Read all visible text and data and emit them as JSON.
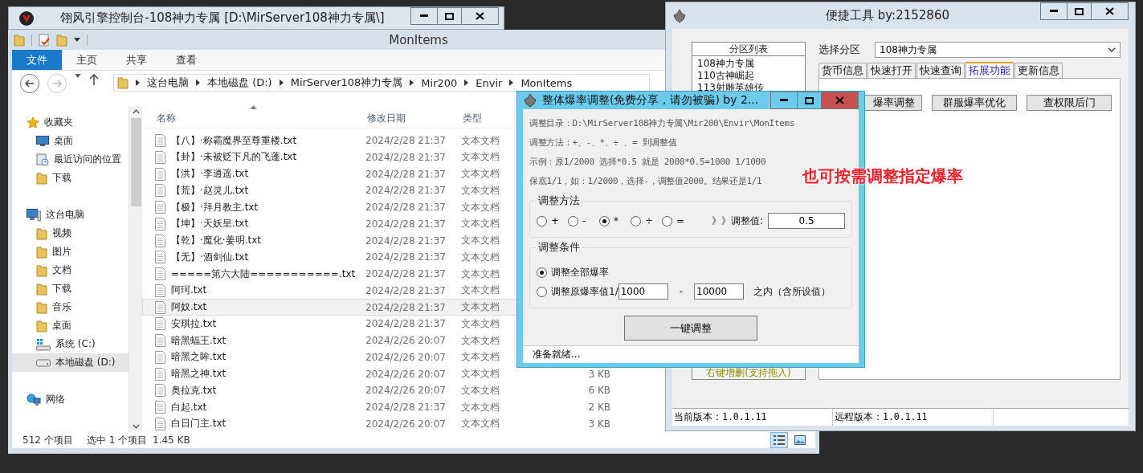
{
  "console_window": {
    "title": "翎风引擎控制台-108神力专属 [D:\\MirServer108神力专属\\]"
  },
  "explorer": {
    "title": "MonItems",
    "ribbon_tabs": [
      {
        "label": "文件",
        "selected": true
      },
      {
        "label": "主页",
        "selected": false
      },
      {
        "label": "共享",
        "selected": false
      },
      {
        "label": "查看",
        "selected": false
      }
    ],
    "breadcrumb": [
      "这台电脑",
      "本地磁盘 (D:)",
      "MirServer108神力专属",
      "Mir200",
      "Envir",
      "MonItems"
    ],
    "sidebar": [
      {
        "label": "收藏夹",
        "kind": "star",
        "selected": false,
        "children": [
          {
            "label": "桌面",
            "kind": "monitor",
            "selected": false
          },
          {
            "label": "最近访问的位置",
            "kind": "recent",
            "selected": false
          },
          {
            "label": "下载",
            "kind": "folder",
            "selected": false
          }
        ]
      },
      {
        "label": "这台电脑",
        "kind": "computer",
        "selected": false,
        "children": [
          {
            "label": "视频",
            "kind": "folder",
            "selected": false
          },
          {
            "label": "图片",
            "kind": "folder",
            "selected": false
          },
          {
            "label": "文档",
            "kind": "folder",
            "selected": false
          },
          {
            "label": "下载",
            "kind": "folder",
            "selected": false
          },
          {
            "label": "音乐",
            "kind": "folder",
            "selected": false
          },
          {
            "label": "桌面",
            "kind": "folder",
            "selected": false
          },
          {
            "label": "系统 (C:)",
            "kind": "system-drive",
            "selected": false
          },
          {
            "label": "本地磁盘 (D:)",
            "kind": "drive",
            "selected": true
          }
        ]
      },
      {
        "label": "网络",
        "kind": "network",
        "selected": false
      }
    ],
    "columns": [
      "名称",
      "修改日期",
      "类型"
    ],
    "rows": [
      {
        "name": "【八】·称霸魔界至尊重楼.txt",
        "date": "2024/2/28 21:37",
        "type": "文本文档",
        "selected": false
      },
      {
        "name": "【卦】·未被贬下凡的飞蓬.txt",
        "date": "2024/2/28 21:37",
        "type": "文本文档",
        "selected": false
      },
      {
        "name": "【洪】·李逍遥.txt",
        "date": "2024/2/28 21:37",
        "type": "文本文档",
        "selected": false
      },
      {
        "name": "【荒】·赵灵儿.txt",
        "date": "2024/2/28 21:37",
        "type": "文本文档",
        "selected": false
      },
      {
        "name": "【极】·拜月教主.txt",
        "date": "2024/2/28 21:37",
        "type": "文本文档",
        "selected": false
      },
      {
        "name": "【坤】·天妖皇.txt",
        "date": "2024/2/28 21:37",
        "type": "文本文档",
        "selected": false
      },
      {
        "name": "【乾】·魔化·姜明.txt",
        "date": "2024/2/28 21:37",
        "type": "文本文档",
        "selected": false
      },
      {
        "name": "【无】·酒剑仙.txt",
        "date": "2024/2/28 21:37",
        "type": "文本文档",
        "selected": false
      },
      {
        "name": "=====第六大陆===========.txt",
        "date": "2024/2/28 21:37",
        "type": "文本文档",
        "selected": false
      },
      {
        "name": "阿珂.txt",
        "date": "2024/2/28 21:37",
        "type": "文本文档",
        "selected": false
      },
      {
        "name": "阿奴.txt",
        "date": "2024/2/28 21:37",
        "type": "文本文档",
        "selected": true
      },
      {
        "name": "安琪拉.txt",
        "date": "2024/2/28 21:37",
        "type": "文本文档",
        "selected": false
      },
      {
        "name": "暗黑蝠王.txt",
        "date": "2024/2/26 20:07",
        "type": "文本文档",
        "selected": false
      },
      {
        "name": "暗黑之眸.txt",
        "date": "2024/2/26 20:07",
        "type": "文本文档",
        "selected": false
      },
      {
        "name": "暗黑之神.txt",
        "date": "2024/2/26 20:07",
        "type": "文本文档",
        "size": "3 KB",
        "selected": false
      },
      {
        "name": "奥拉克.txt",
        "date": "2024/2/26 20:07",
        "type": "文本文档",
        "size": "6 KB",
        "selected": false
      },
      {
        "name": "白起.txt",
        "date": "2024/2/28 21:37",
        "type": "文本文档",
        "size": "2 KB",
        "selected": false
      },
      {
        "name": "白日门主.txt",
        "date": "2024/2/26 20:07",
        "type": "文本文档",
        "size": "3 KB",
        "selected": false
      }
    ],
    "status": [
      "512 个项目",
      "选中 1 个项目",
      "1.45 KB"
    ]
  },
  "tool_window": {
    "title": "便捷工具 by:2152860",
    "partition_list": {
      "header": "分区列表",
      "items": [
        "108神力专属",
        "110古神崛起",
        "113射雕英雄传"
      ]
    },
    "list_button": "右键增删(支持拖入)",
    "select_label": "选择分区",
    "select_value": "108神力专属",
    "tabs": [
      {
        "label": "货币信息",
        "selected": false
      },
      {
        "label": "快速打开",
        "selected": false
      },
      {
        "label": "快速查询",
        "selected": false
      },
      {
        "label": "拓展功能",
        "selected": true
      },
      {
        "label": "更新信息",
        "selected": false
      }
    ],
    "buttons": [
      "爆率调整",
      "群服爆率优化",
      "查权限后门"
    ],
    "status": [
      "当前版本：1.0.1.11",
      "远程版本：1.0.1.11"
    ]
  },
  "dialog": {
    "title": "整体爆率调整(免费分享，请勿被骗)   by 2...",
    "info_lines": [
      "调整目录：D:\\MirServer108神力专属\\Mir200\\Envir\\MonItems",
      "调整方法：+、-、*、÷ 、=   到调整值",
      "示例：原1/2000 选择*0.5 就是 2000*0.5=1000  1/1000",
      "保底1/1，如：1/2000，选择-，调整值2000。结果还是1/1"
    ],
    "method": {
      "title": "调整方法",
      "options": [
        {
          "label": "+",
          "selected": false
        },
        {
          "label": "-",
          "selected": false
        },
        {
          "label": "*",
          "selected": true
        },
        {
          "label": "÷",
          "selected": false
        },
        {
          "label": "=",
          "selected": false
        }
      ],
      "value_label": "》》调整值:",
      "value": "0.5"
    },
    "condition": {
      "title": "调整条件",
      "options": [
        {
          "kind": "all",
          "label": "调整全部爆率",
          "selected": true
        },
        {
          "kind": "range",
          "label": "调整原爆率值1/",
          "from": "1000",
          "dash": "-",
          "to": "10000",
          "suffix": "之内（含所设值）",
          "selected": false
        }
      ]
    },
    "button": "一键调整",
    "status": "准备就绪..."
  },
  "annotation": "也可按需调整指定爆率"
}
